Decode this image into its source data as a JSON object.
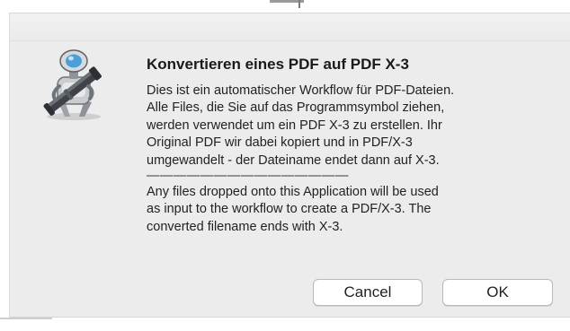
{
  "dialog": {
    "icon": "automator-robot-icon",
    "title": "Konvertieren eines PDF auf PDF X-3",
    "message_lines": [
      "Dies ist ein automatischer Workflow für PDF-Dateien.",
      "Alle Files, die Sie auf das Programmsymbol ziehen,",
      "werden verwendet um ein PDF X-3 zu erstellen. Ihr",
      "Original PDF wir dabei kopiert und in PDF/X-3",
      "umgewandelt - der Dateiname endet dann auf X-3.",
      "———————————————",
      "Any files dropped onto this Application will be used",
      "as input to the workflow to create a PDF/X-3. The",
      "converted filename ends with X-3."
    ],
    "buttons": {
      "cancel_label": "Cancel",
      "ok_label": "OK"
    }
  },
  "colors": {
    "dialog_background": "#ececec",
    "button_background": "#ffffff",
    "text": "#222222"
  }
}
